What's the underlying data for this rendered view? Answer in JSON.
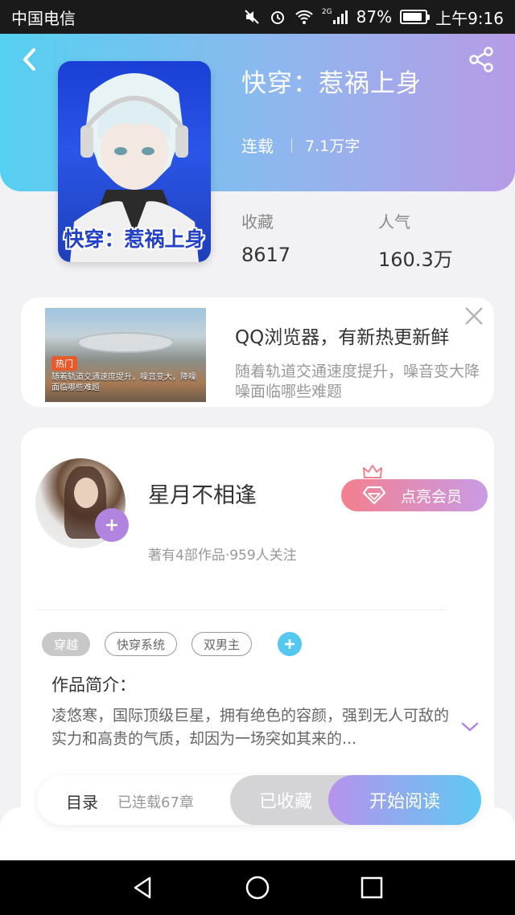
{
  "status_bar": {
    "carrier": "中国电信",
    "network": "2G",
    "battery": "87%",
    "battery_level": 0.87,
    "time": "上午9:16"
  },
  "book": {
    "title": "快穿：惹祸上身",
    "cover_title": "快穿：惹祸上身",
    "status": "连载",
    "word_count": "7.1万字",
    "stats": [
      {
        "label": "收藏",
        "value": "8617"
      },
      {
        "label": "人气",
        "value": "160.3万"
      }
    ]
  },
  "ad": {
    "heading": "QQ浏览器，有新热更新鲜",
    "description": "随着轨道交通速度提升，噪音变大降噪面临哪些难题",
    "image_tag": "热门",
    "image_caption": "随着轨道交通速度提升，噪音变大，降噪面临哪些难题"
  },
  "author": {
    "name": "星月不相逢",
    "stats": "著有4部作品·959人关注",
    "vip_label": "点亮会员"
  },
  "tags": [
    "穿越",
    "快穿系统",
    "双男主"
  ],
  "intro": {
    "heading": "作品简介：",
    "text": "凌悠寒，国际顶级巨星，拥有绝色的容颜，强到无人可敌的实力和高贵的气质，却因为一场突如其来的..."
  },
  "action_bar": {
    "toc_label": "目录",
    "chapter_count": "已连载67章",
    "collected_label": "已收藏",
    "read_label": "开始阅读"
  },
  "colors": {
    "header_start": "#55d0f0",
    "header_end": "#b79be6",
    "accent_purple": "#b184e0",
    "accent_blue": "#5ec9f2"
  }
}
